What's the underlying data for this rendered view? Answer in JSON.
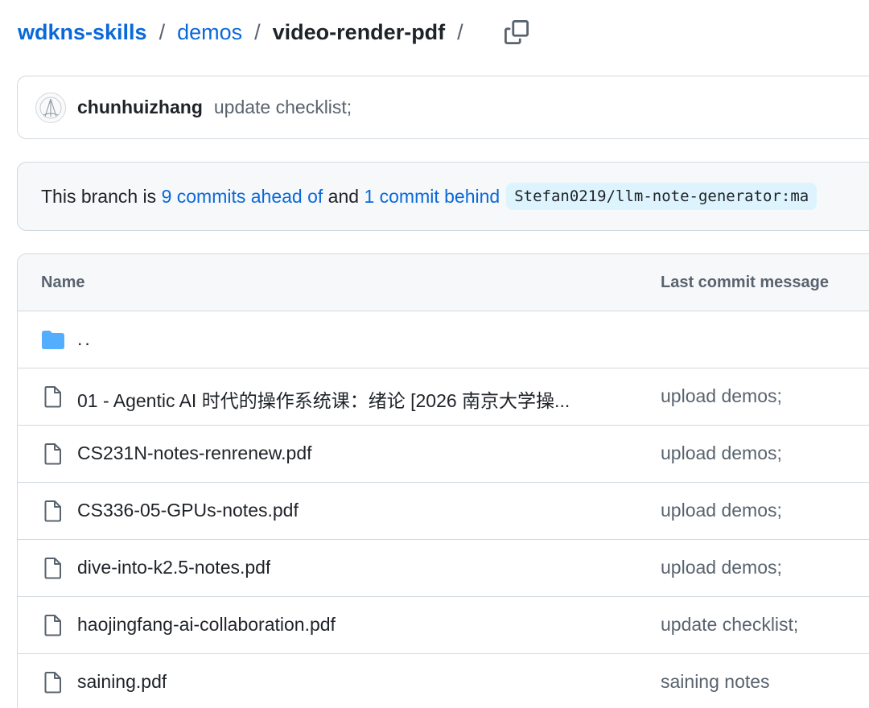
{
  "breadcrumb": {
    "repo": "wdkns-skills",
    "folder": "demos",
    "current": "video-render-pdf",
    "separator": "/"
  },
  "latest_commit": {
    "author": "chunhuizhang",
    "message": "update checklist;"
  },
  "branch_status": {
    "prefix": "This branch is",
    "ahead_link": "9 commits ahead of",
    "and": "and",
    "behind_link": "1 commit behind",
    "upstream_ref": "Stefan0219/llm-note-generator:ma"
  },
  "table": {
    "headers": {
      "name": "Name",
      "last_commit": "Last commit message"
    },
    "parent_dir": "..",
    "rows": [
      {
        "name": "01 - Agentic AI 时代的操作系统课：绪论 [2026 南京大学操...",
        "commit": "upload demos;"
      },
      {
        "name": "CS231N-notes-renrenew.pdf",
        "commit": "upload demos;"
      },
      {
        "name": "CS336-05-GPUs-notes.pdf",
        "commit": "upload demos;"
      },
      {
        "name": "dive-into-k2.5-notes.pdf",
        "commit": "upload demos;"
      },
      {
        "name": "haojingfang-ai-collaboration.pdf",
        "commit": "update checklist;"
      },
      {
        "name": "saining.pdf",
        "commit": "saining notes"
      }
    ]
  },
  "icons": {
    "copy": "copy-icon",
    "folder": "folder-icon",
    "file": "file-icon",
    "avatar": "avatar"
  },
  "colors": {
    "link": "#0969da",
    "folder": "#54aeff",
    "muted": "#59636e",
    "border": "#d1d9e0",
    "ref_bg": "#ddf4ff"
  }
}
